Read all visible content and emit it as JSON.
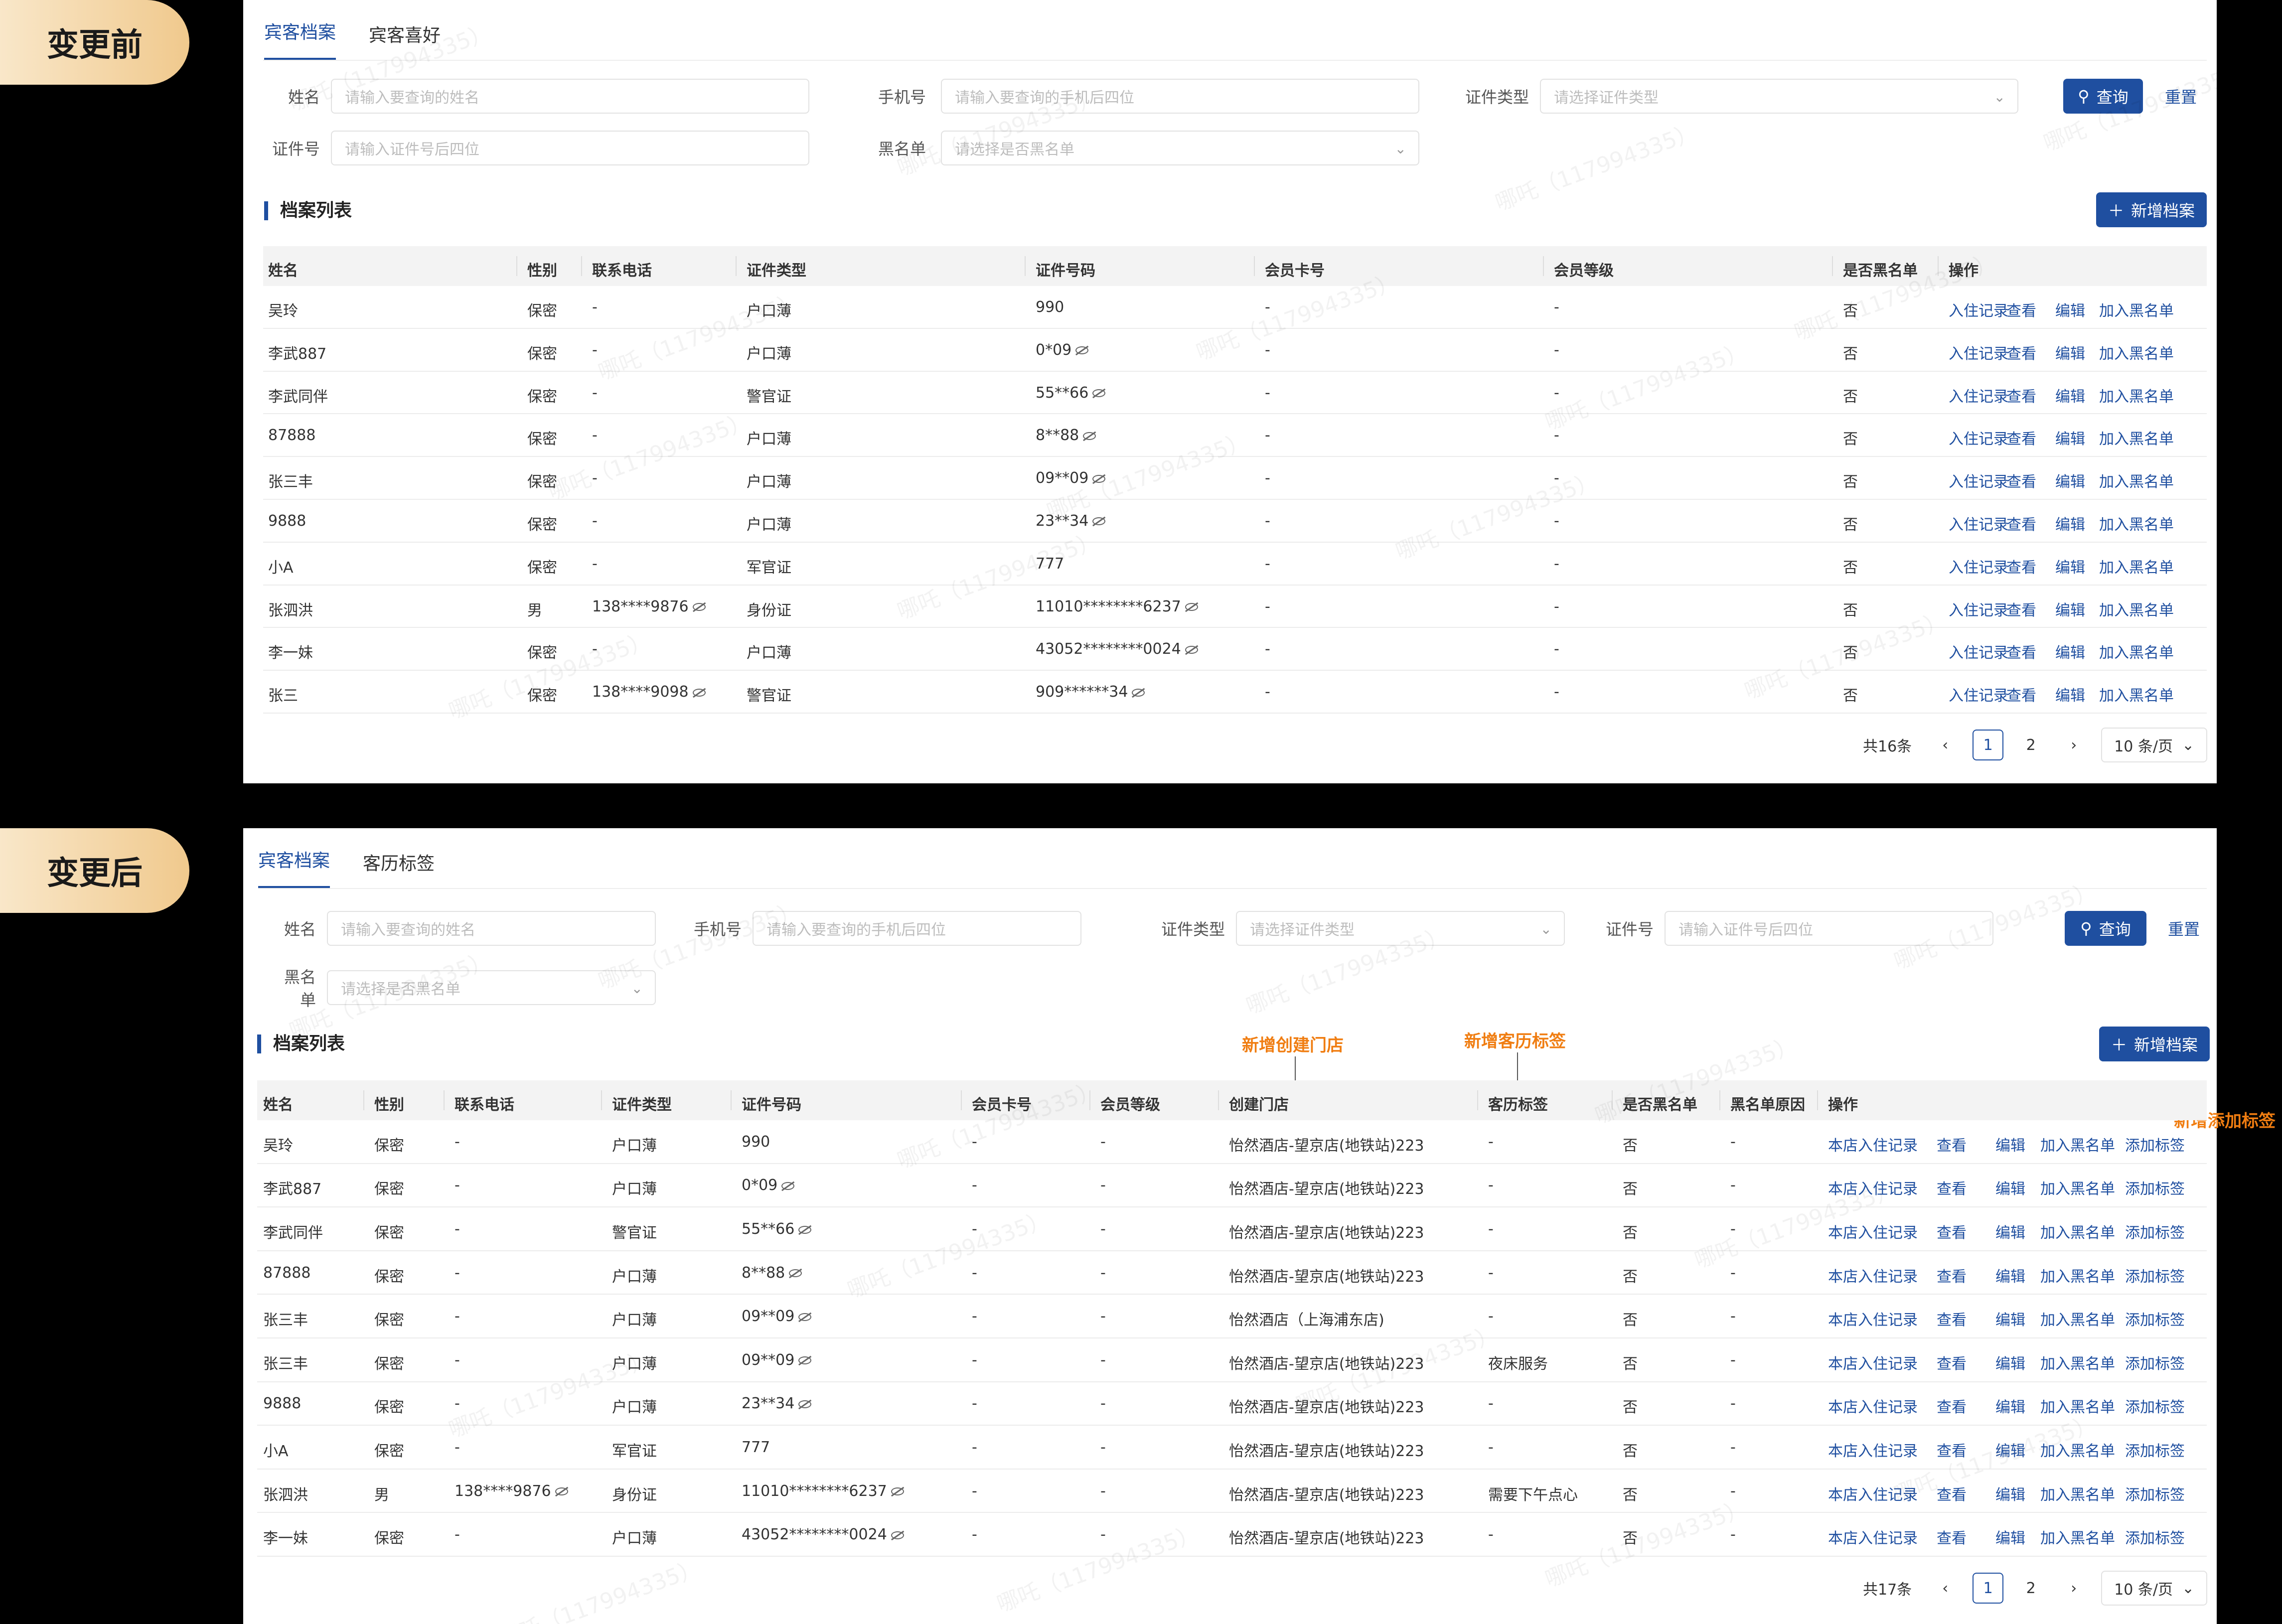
{
  "badges": {
    "before": "变更前",
    "after": "变更后"
  },
  "watermark": "哪吒（117994335）",
  "before": {
    "tabs": [
      "宾客档案",
      "宾客喜好"
    ],
    "filters": {
      "name_label": "姓名",
      "name_ph": "请输入要查询的姓名",
      "phone_label": "手机号",
      "phone_ph": "请输入要查询的手机后四位",
      "idtype_label": "证件类型",
      "idtype_ph": "请选择证件类型",
      "idno_label": "证件号",
      "idno_ph": "请输入证件号后四位",
      "black_label": "黑名单",
      "black_ph": "请选择是否黑名单"
    },
    "query": "查询",
    "reset": "重置",
    "section": "档案列表",
    "add": "新增档案",
    "columns": [
      "姓名",
      "性别",
      "联系电话",
      "证件类型",
      "证件号码",
      "会员卡号",
      "会员等级",
      "是否黑名单",
      "操作"
    ],
    "actions": [
      "入住记录",
      "查看",
      "编辑",
      "加入黑名单"
    ],
    "rows": [
      {
        "name": "吴玲",
        "sex": "保密",
        "phone": "-",
        "idtype": "户口薄",
        "idno": "990",
        "eye": false,
        "card": "-",
        "level": "-",
        "black": "否"
      },
      {
        "name": "李武887",
        "sex": "保密",
        "phone": "-",
        "idtype": "户口薄",
        "idno": "0*09",
        "eye": true,
        "card": "-",
        "level": "-",
        "black": "否"
      },
      {
        "name": "李武同伴",
        "sex": "保密",
        "phone": "-",
        "idtype": "警官证",
        "idno": "55**66",
        "eye": true,
        "card": "-",
        "level": "-",
        "black": "否"
      },
      {
        "name": "87888",
        "sex": "保密",
        "phone": "-",
        "idtype": "户口薄",
        "idno": "8**88",
        "eye": true,
        "card": "-",
        "level": "-",
        "black": "否"
      },
      {
        "name": "张三丰",
        "sex": "保密",
        "phone": "-",
        "idtype": "户口薄",
        "idno": "09**09",
        "eye": true,
        "card": "-",
        "level": "-",
        "black": "否"
      },
      {
        "name": "9888",
        "sex": "保密",
        "phone": "-",
        "idtype": "户口薄",
        "idno": "23**34",
        "eye": true,
        "card": "-",
        "level": "-",
        "black": "否"
      },
      {
        "name": "小A",
        "sex": "保密",
        "phone": "-",
        "idtype": "军官证",
        "idno": "777",
        "eye": false,
        "card": "-",
        "level": "-",
        "black": "否"
      },
      {
        "name": "张泗洪",
        "sex": "男",
        "phone": "138****9876",
        "peye": true,
        "idtype": "身份证",
        "idno": "11010********6237",
        "eye": true,
        "card": "-",
        "level": "-",
        "black": "否"
      },
      {
        "name": "李一妹",
        "sex": "保密",
        "phone": "-",
        "idtype": "户口薄",
        "idno": "43052********0024",
        "eye": true,
        "card": "-",
        "level": "-",
        "black": "否"
      },
      {
        "name": "张三",
        "sex": "保密",
        "phone": "138****9098",
        "peye": true,
        "idtype": "警官证",
        "idno": "909******34",
        "eye": true,
        "card": "-",
        "level": "-",
        "black": "否"
      }
    ],
    "pager": {
      "total": "共16条",
      "pages": [
        "1",
        "2"
      ],
      "current": "1",
      "size": "10 条/页"
    }
  },
  "after": {
    "tabs": [
      "宾客档案",
      "客历标签"
    ],
    "filters": {
      "name_label": "姓名",
      "name_ph": "请输入要查询的姓名",
      "phone_label": "手机号",
      "phone_ph": "请输入要查询的手机后四位",
      "idtype_label": "证件类型",
      "idtype_ph": "请选择证件类型",
      "idno_label": "证件号",
      "idno_ph": "请输入证件号后四位",
      "black_label": "黑名单",
      "black_ph": "请选择是否黑名单"
    },
    "query": "查询",
    "reset": "重置",
    "section": "档案列表",
    "add": "新增档案",
    "columns": [
      "姓名",
      "性别",
      "联系电话",
      "证件类型",
      "证件号码",
      "会员卡号",
      "会员等级",
      "创建门店",
      "客历标签",
      "是否黑名单",
      "黑名单原因",
      "操作"
    ],
    "actions": [
      "本店入住记录",
      "查看",
      "编辑",
      "加入黑名单",
      "添加标签"
    ],
    "notes": {
      "store": "新增创建门店",
      "tag": "新增客历标签",
      "addtag": "新增添加标签"
    },
    "rows": [
      {
        "name": "吴玲",
        "sex": "保密",
        "phone": "-",
        "idtype": "户口薄",
        "idno": "990",
        "eye": false,
        "card": "-",
        "level": "-",
        "store": "怡然酒店-望京店(地铁站)223",
        "tag": "-",
        "black": "否",
        "reason": "-"
      },
      {
        "name": "李武887",
        "sex": "保密",
        "phone": "-",
        "idtype": "户口薄",
        "idno": "0*09",
        "eye": true,
        "card": "-",
        "level": "-",
        "store": "怡然酒店-望京店(地铁站)223",
        "tag": "-",
        "black": "否",
        "reason": "-"
      },
      {
        "name": "李武同伴",
        "sex": "保密",
        "phone": "-",
        "idtype": "警官证",
        "idno": "55**66",
        "eye": true,
        "card": "-",
        "level": "-",
        "store": "怡然酒店-望京店(地铁站)223",
        "tag": "-",
        "black": "否",
        "reason": "-"
      },
      {
        "name": "87888",
        "sex": "保密",
        "phone": "-",
        "idtype": "户口薄",
        "idno": "8**88",
        "eye": true,
        "card": "-",
        "level": "-",
        "store": "怡然酒店-望京店(地铁站)223",
        "tag": "-",
        "black": "否",
        "reason": "-"
      },
      {
        "name": "张三丰",
        "sex": "保密",
        "phone": "-",
        "idtype": "户口薄",
        "idno": "09**09",
        "eye": true,
        "card": "-",
        "level": "-",
        "store": "怡然酒店（上海浦东店)",
        "tag": "-",
        "black": "否",
        "reason": "-"
      },
      {
        "name": "张三丰",
        "sex": "保密",
        "phone": "-",
        "idtype": "户口薄",
        "idno": "09**09",
        "eye": true,
        "card": "-",
        "level": "-",
        "store": "怡然酒店-望京店(地铁站)223",
        "tag": "夜床服务",
        "black": "否",
        "reason": "-"
      },
      {
        "name": "9888",
        "sex": "保密",
        "phone": "-",
        "idtype": "户口薄",
        "idno": "23**34",
        "eye": true,
        "card": "-",
        "level": "-",
        "store": "怡然酒店-望京店(地铁站)223",
        "tag": "-",
        "black": "否",
        "reason": "-"
      },
      {
        "name": "小A",
        "sex": "保密",
        "phone": "-",
        "idtype": "军官证",
        "idno": "777",
        "eye": false,
        "card": "-",
        "level": "-",
        "store": "怡然酒店-望京店(地铁站)223",
        "tag": "-",
        "black": "否",
        "reason": "-"
      },
      {
        "name": "张泗洪",
        "sex": "男",
        "phone": "138****9876",
        "peye": true,
        "idtype": "身份证",
        "idno": "11010********6237",
        "eye": true,
        "card": "-",
        "level": "-",
        "store": "怡然酒店-望京店(地铁站)223",
        "tag": "需要下午点心",
        "black": "否",
        "reason": "-"
      },
      {
        "name": "李一妹",
        "sex": "保密",
        "phone": "-",
        "idtype": "户口薄",
        "idno": "43052********0024",
        "eye": true,
        "card": "-",
        "level": "-",
        "store": "怡然酒店-望京店(地铁站)223",
        "tag": "-",
        "black": "否",
        "reason": "-"
      }
    ],
    "pager": {
      "total": "共17条",
      "pages": [
        "1",
        "2"
      ],
      "current": "1",
      "size": "10 条/页"
    }
  }
}
